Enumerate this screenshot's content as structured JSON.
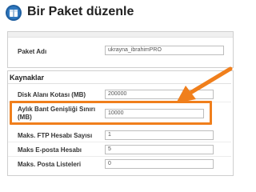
{
  "header": {
    "title": "Bir Paket düzenle",
    "icon": "package-gear-icon"
  },
  "package_name": {
    "label": "Paket Adı",
    "value": "ukrayna_ibrahimPRO"
  },
  "resources": {
    "title": "Kaynaklar",
    "rows": [
      {
        "label": "Disk Alanı Kotası (MB)",
        "value": "200000"
      },
      {
        "label_line1": "Aylık Bant Genişliği Sınırı",
        "label_line2": "(MB)",
        "value": "10000"
      },
      {
        "label": "Maks. FTP Hesabı Sayısı",
        "value": "1"
      },
      {
        "label": "Maks E-posta Hesabı",
        "value": "5"
      },
      {
        "label": "Maks. Posta Listeleri",
        "value": "0"
      }
    ]
  },
  "colors": {
    "highlight": "#f07f1c",
    "icon_blue": "#1f5fa0"
  }
}
